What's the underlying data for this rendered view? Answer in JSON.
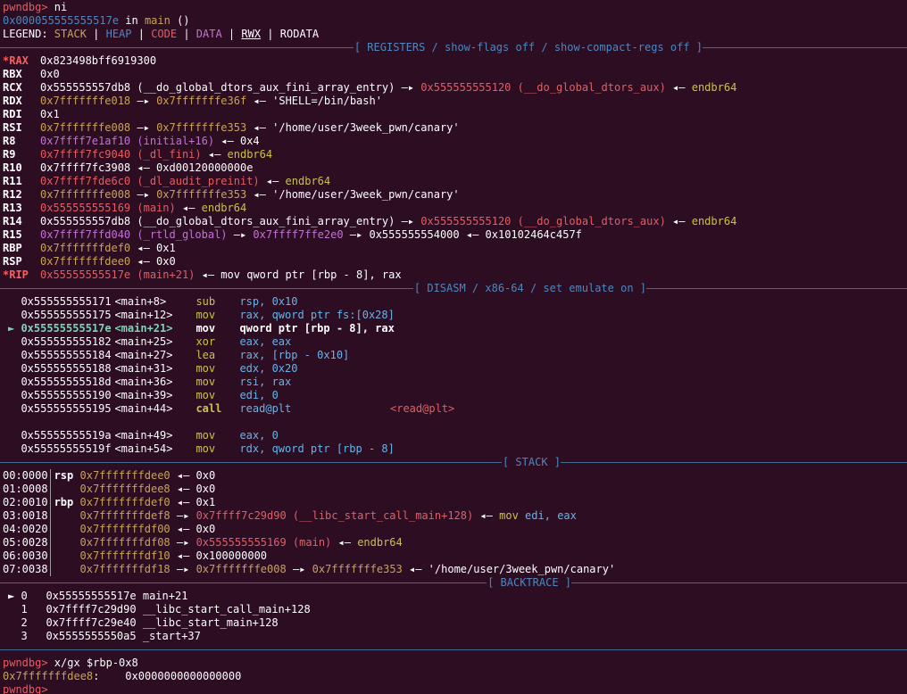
{
  "header": {
    "prompt": "pwndbg>",
    "cmd1": " ni",
    "loc_addr": "0x000055555555517e",
    "loc_in": " in ",
    "loc_fn": "main",
    "loc_parens": " ()",
    "legend_label": "LEGEND: ",
    "legend_stack": "STACK",
    "legend_heap": "HEAP",
    "legend_code": "CODE",
    "legend_data": "DATA",
    "legend_rwx": "RWX",
    "legend_rodata": "RODATA",
    "pipe": " | "
  },
  "sections": {
    "registers": "[ REGISTERS / show-flags off / show-compact-regs off ]",
    "disasm": "[ DISASM / x86-64 / set emulate on ]",
    "stack": "[ STACK ]",
    "backtrace": "[ BACKTRACE ]"
  },
  "registers": [
    {
      "name": "*RAX",
      "mod": true,
      "parts": [
        {
          "t": "0x823498bff6919300",
          "c": "val"
        }
      ]
    },
    {
      "name": "RBX",
      "mod": false,
      "parts": [
        {
          "t": "0x0",
          "c": "val"
        }
      ]
    },
    {
      "name": "RCX",
      "mod": false,
      "parts": [
        {
          "t": "0x555555557db8 (__do_global_dtors_aux_fini_array_entry) ",
          "c": "val"
        },
        {
          "t": "—▸ ",
          "c": "arrow"
        },
        {
          "t": "0x555555555120 (__do_global_dtors_aux)",
          "c": "code"
        },
        {
          "t": " ◂— ",
          "c": "arrow"
        },
        {
          "t": "endbr64",
          "c": "greenop"
        }
      ]
    },
    {
      "name": "RDX",
      "mod": false,
      "parts": [
        {
          "t": "0x7fffffffe018",
          "c": "stack-addr"
        },
        {
          "t": " —▸ ",
          "c": "arrow"
        },
        {
          "t": "0x7fffffffe36f",
          "c": "stack-addr"
        },
        {
          "t": " ◂— 'SHELL=/bin/bash'",
          "c": "str"
        }
      ]
    },
    {
      "name": "RDI",
      "mod": false,
      "parts": [
        {
          "t": "0x1",
          "c": "val"
        }
      ]
    },
    {
      "name": "RSI",
      "mod": false,
      "parts": [
        {
          "t": "0x7fffffffe008",
          "c": "stack-addr"
        },
        {
          "t": " —▸ ",
          "c": "arrow"
        },
        {
          "t": "0x7fffffffe353",
          "c": "stack-addr"
        },
        {
          "t": " ◂— '/home/user/3week_pwn/canary'",
          "c": "str"
        }
      ]
    },
    {
      "name": "R8",
      "mod": false,
      "parts": [
        {
          "t": "0x7ffff7e1af10 (initial+16)",
          "c": "data"
        },
        {
          "t": " ◂— 0x4",
          "c": "val"
        }
      ]
    },
    {
      "name": "R9",
      "mod": false,
      "parts": [
        {
          "t": "0x7ffff7fc9040 (_dl_fini)",
          "c": "code"
        },
        {
          "t": " ◂— ",
          "c": "arrow"
        },
        {
          "t": "endbr64",
          "c": "greenop"
        }
      ]
    },
    {
      "name": "R10",
      "mod": false,
      "parts": [
        {
          "t": "0x7ffff7fc3908 ◂— 0xd00120000000e",
          "c": "val"
        }
      ]
    },
    {
      "name": "R11",
      "mod": false,
      "parts": [
        {
          "t": "0x7ffff7fde6c0 (_dl_audit_preinit)",
          "c": "code"
        },
        {
          "t": " ◂— ",
          "c": "arrow"
        },
        {
          "t": "endbr64",
          "c": "greenop"
        }
      ]
    },
    {
      "name": "R12",
      "mod": false,
      "parts": [
        {
          "t": "0x7fffffffe008",
          "c": "stack-addr"
        },
        {
          "t": " —▸ ",
          "c": "arrow"
        },
        {
          "t": "0x7fffffffe353",
          "c": "stack-addr"
        },
        {
          "t": " ◂— '/home/user/3week_pwn/canary'",
          "c": "str"
        }
      ]
    },
    {
      "name": "R13",
      "mod": false,
      "parts": [
        {
          "t": "0x555555555169 (main)",
          "c": "code"
        },
        {
          "t": " ◂— ",
          "c": "arrow"
        },
        {
          "t": "endbr64",
          "c": "greenop"
        }
      ]
    },
    {
      "name": "R14",
      "mod": false,
      "parts": [
        {
          "t": "0x555555557db8 (__do_global_dtors_aux_fini_array_entry) ",
          "c": "val"
        },
        {
          "t": "—▸ ",
          "c": "arrow"
        },
        {
          "t": "0x555555555120 (__do_global_dtors_aux)",
          "c": "code"
        },
        {
          "t": " ◂— ",
          "c": "arrow"
        },
        {
          "t": "endbr64",
          "c": "greenop"
        }
      ]
    },
    {
      "name": "R15",
      "mod": false,
      "parts": [
        {
          "t": "0x7ffff7ffd040 (_rtld_global)",
          "c": "data"
        },
        {
          "t": " —▸ ",
          "c": "arrow"
        },
        {
          "t": "0x7ffff7ffe2e0",
          "c": "data"
        },
        {
          "t": " —▸ 0x555555554000 ◂— 0x10102464c457f",
          "c": "val"
        }
      ]
    },
    {
      "name": "RBP",
      "mod": false,
      "parts": [
        {
          "t": "0x7fffffffdef0",
          "c": "stack-addr"
        },
        {
          "t": " ◂— 0x1",
          "c": "val"
        }
      ]
    },
    {
      "name": "RSP",
      "mod": false,
      "parts": [
        {
          "t": "0x7fffffffdee0",
          "c": "stack-addr"
        },
        {
          "t": " ◂— 0x0",
          "c": "val"
        }
      ]
    },
    {
      "name": "*RIP",
      "mod": true,
      "parts": [
        {
          "t": "0x55555555517e (main+21)",
          "c": "code"
        },
        {
          "t": " ◂— mov qword ptr [rbp - 8], rax",
          "c": "val"
        }
      ]
    }
  ],
  "disasm": [
    {
      "marker": "  ",
      "addr": "0x555555555171",
      "sym": "<main+8>",
      "op": "sub",
      "args": "rsp, 0x10",
      "current": false
    },
    {
      "marker": "  ",
      "addr": "0x555555555175",
      "sym": "<main+12>",
      "op": "mov",
      "args": "rax, qword ptr fs:[0x28]",
      "current": false
    },
    {
      "marker": "► ",
      "addr": "0x55555555517e",
      "sym": "<main+21>",
      "op": "mov",
      "args": "qword ptr [rbp - 8], rax",
      "current": true
    },
    {
      "marker": "  ",
      "addr": "0x555555555182",
      "sym": "<main+25>",
      "op": "xor",
      "args": "eax, eax",
      "current": false
    },
    {
      "marker": "  ",
      "addr": "0x555555555184",
      "sym": "<main+27>",
      "op": "lea",
      "args": "rax, [rbp - 0x10]",
      "current": false
    },
    {
      "marker": "  ",
      "addr": "0x555555555188",
      "sym": "<main+31>",
      "op": "mov",
      "args": "edx, 0x20",
      "current": false
    },
    {
      "marker": "  ",
      "addr": "0x55555555518d",
      "sym": "<main+36>",
      "op": "mov",
      "args": "rsi, rax",
      "current": false
    },
    {
      "marker": "  ",
      "addr": "0x555555555190",
      "sym": "<main+39>",
      "op": "mov",
      "args": "edi, 0",
      "current": false
    },
    {
      "marker": "  ",
      "addr": "0x555555555195",
      "sym": "<main+44>",
      "op": "call",
      "args": "read@plt",
      "current": false,
      "call": true,
      "target": "<read@plt>"
    },
    {
      "marker": "",
      "addr": "",
      "sym": "",
      "op": "",
      "args": "",
      "current": false,
      "blank": true
    },
    {
      "marker": "  ",
      "addr": "0x55555555519a",
      "sym": "<main+49>",
      "op": "mov",
      "args": "eax, 0",
      "current": false
    },
    {
      "marker": "  ",
      "addr": "0x55555555519f",
      "sym": "<main+54>",
      "op": "mov",
      "args": "rdx, qword ptr [rbp - 8]",
      "current": false
    }
  ],
  "stack": [
    {
      "off": "00:0000",
      "reg": "rsp",
      "addr": "0x7fffffffdee0",
      "rest": [
        {
          "t": " ◂— 0x0",
          "c": "val"
        }
      ]
    },
    {
      "off": "01:0008",
      "reg": "   ",
      "addr": "0x7fffffffdee8",
      "rest": [
        {
          "t": " ◂— 0x0",
          "c": "val"
        }
      ]
    },
    {
      "off": "02:0010",
      "reg": "rbp",
      "addr": "0x7fffffffdef0",
      "rest": [
        {
          "t": " ◂— 0x1",
          "c": "val"
        }
      ]
    },
    {
      "off": "03:0018",
      "reg": "   ",
      "addr": "0x7fffffffdef8",
      "rest": [
        {
          "t": " —▸ ",
          "c": "arrow"
        },
        {
          "t": "0x7ffff7c29d90 (__libc_start_call_main+128)",
          "c": "code"
        },
        {
          "t": " ◂— ",
          "c": "arrow"
        },
        {
          "t": "mov",
          "c": "greenop"
        },
        {
          "t": " edi, ",
          "c": "imm"
        },
        {
          "t": "eax",
          "c": "imm"
        }
      ]
    },
    {
      "off": "04:0020",
      "reg": "   ",
      "addr": "0x7fffffffdf00",
      "rest": [
        {
          "t": " ◂— 0x0",
          "c": "val"
        }
      ]
    },
    {
      "off": "05:0028",
      "reg": "   ",
      "addr": "0x7fffffffdf08",
      "rest": [
        {
          "t": " —▸ ",
          "c": "arrow"
        },
        {
          "t": "0x555555555169 (main)",
          "c": "code"
        },
        {
          "t": " ◂— ",
          "c": "arrow"
        },
        {
          "t": "endbr64",
          "c": "greenop"
        }
      ]
    },
    {
      "off": "06:0030",
      "reg": "   ",
      "addr": "0x7fffffffdf10",
      "rest": [
        {
          "t": " ◂— 0x100000000",
          "c": "val"
        }
      ]
    },
    {
      "off": "07:0038",
      "reg": "   ",
      "addr": "0x7fffffffdf18",
      "rest": [
        {
          "t": " —▸ ",
          "c": "arrow"
        },
        {
          "t": "0x7fffffffe008",
          "c": "stack-addr"
        },
        {
          "t": " —▸ ",
          "c": "arrow"
        },
        {
          "t": "0x7fffffffe353",
          "c": "stack-addr"
        },
        {
          "t": " ◂— '/home/user/3week_pwn/canary'",
          "c": "str"
        }
      ]
    }
  ],
  "backtrace": [
    {
      "marker": "► ",
      "idx": "0",
      "addr": "0x55555555517e",
      "sym": "main+21"
    },
    {
      "marker": "  ",
      "idx": "1",
      "addr": "0x7ffff7c29d90",
      "sym": "__libc_start_call_main+128"
    },
    {
      "marker": "  ",
      "idx": "2",
      "addr": "0x7ffff7c29e40",
      "sym": "__libc_start_main+128"
    },
    {
      "marker": "  ",
      "idx": "3",
      "addr": "0x5555555550a5",
      "sym": "_start+37"
    }
  ],
  "footer": {
    "cmd2": " x/gx $rbp-0x8",
    "mem_addr": "0x7fffffffdee8",
    "mem_val": ":    0x0000000000000000"
  }
}
